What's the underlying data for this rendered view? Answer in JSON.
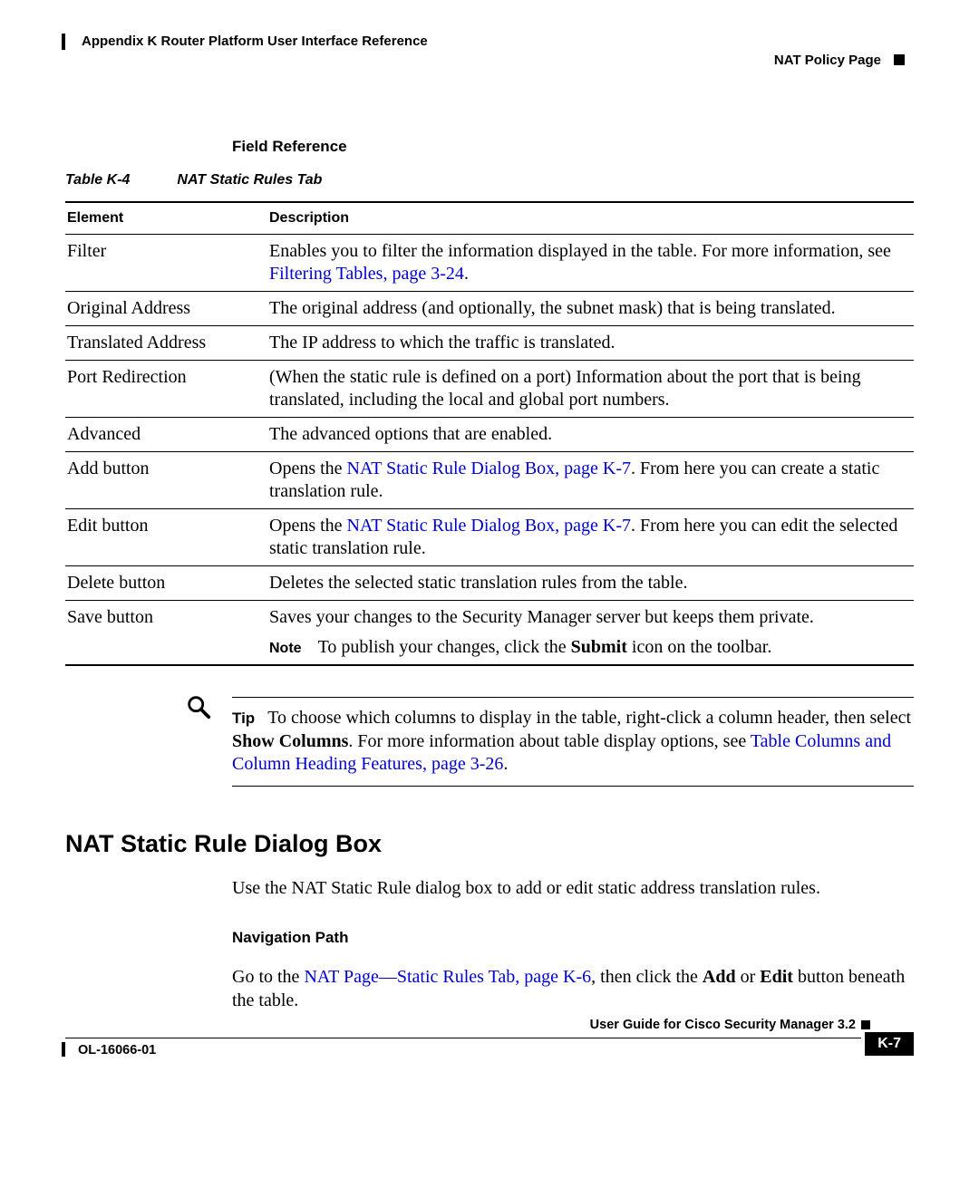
{
  "header": {
    "appendix": "Appendix K      Router Platform User Interface Reference",
    "section": "NAT Policy Page"
  },
  "field_reference_heading": "Field Reference",
  "table_caption_num": "Table K-4",
  "table_caption_title": "NAT Static Rules Tab",
  "table": {
    "col1": "Element",
    "col2": "Description",
    "rows": {
      "filter": {
        "el": "Filter",
        "d1": "Enables you to filter the information displayed in the table. For more information, see ",
        "link": "Filtering Tables, page 3-24",
        "d2": "."
      },
      "orig": {
        "el": "Original Address",
        "d": "The original address (and optionally, the subnet mask) that is being translated."
      },
      "trans": {
        "el": "Translated Address",
        "d": "The IP address to which the traffic is translated."
      },
      "port": {
        "el": "Port Redirection",
        "d": "(When the static rule is defined on a port) Information about the port that is being translated, including the local and global port numbers."
      },
      "adv": {
        "el": "Advanced",
        "d": "The advanced options that are enabled."
      },
      "add": {
        "el": "Add button",
        "d1": "Opens the ",
        "link": "NAT Static Rule Dialog Box, page K-7",
        "d2": ". From here you can create a static translation rule."
      },
      "edit": {
        "el": "Edit button",
        "d1": "Opens the ",
        "link": "NAT Static Rule Dialog Box, page K-7",
        "d2": ". From here you can edit the selected static translation rule."
      },
      "del": {
        "el": "Delete button",
        "d": "Deletes the selected static translation rules from the table."
      },
      "save": {
        "el": "Save button",
        "d": "Saves your changes to the Security Manager server but keeps them private.",
        "note_label": "Note",
        "note1": "To publish your changes, click the ",
        "note_bold": "Submit",
        "note2": " icon on the toolbar."
      }
    }
  },
  "tip": {
    "label": "Tip",
    "t1": "To choose which columns to display in the table, right-click a column header, then select ",
    "bold": "Show Columns",
    "t2": ". For more information about table display options, see ",
    "link": "Table Columns and Column Heading Features, page 3-26",
    "t3": "."
  },
  "section_title": "NAT Static Rule Dialog Box",
  "intro": "Use the NAT Static Rule dialog box to add or edit static address translation rules.",
  "nav_path_heading": "Navigation Path",
  "nav": {
    "t1": "Go to the ",
    "link": "NAT Page—Static Rules Tab, page K-6",
    "t2": ", then click the ",
    "b1": "Add",
    "t3": " or ",
    "b2": "Edit",
    "t4": " button beneath the table."
  },
  "footer": {
    "guide": "User Guide for Cisco Security Manager 3.2",
    "ol": "OL-16066-01",
    "page": "K-7"
  }
}
